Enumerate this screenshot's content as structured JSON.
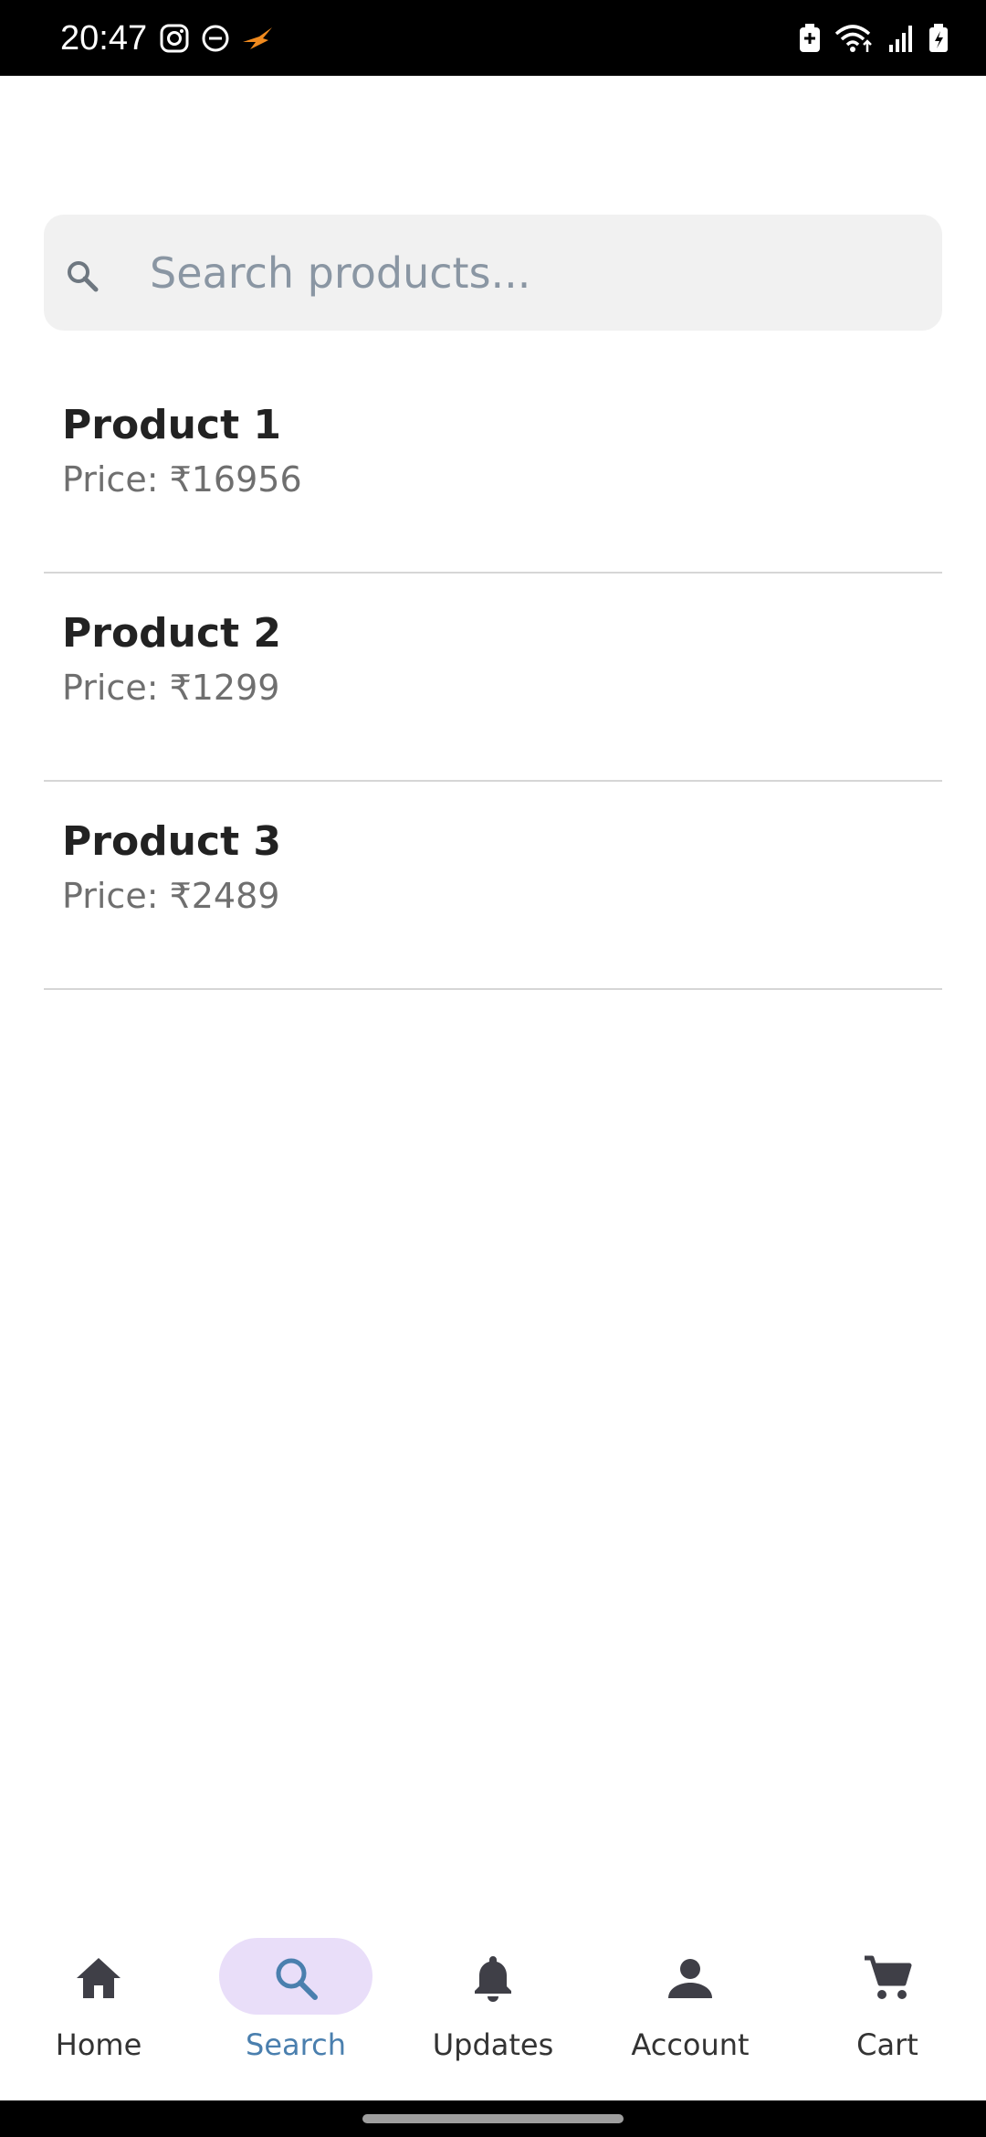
{
  "status_bar": {
    "time": "20:47",
    "left_icons": [
      "instagram-icon",
      "do-not-disturb-icon",
      "app-notification-icon"
    ],
    "right_icons": [
      "battery-saver-icon",
      "wifi-icon",
      "signal-icon",
      "battery-charging-icon"
    ]
  },
  "search": {
    "placeholder": "Search products...",
    "value": ""
  },
  "products": [
    {
      "name": "Product 1",
      "price": "Price: ₹16956"
    },
    {
      "name": "Product 2",
      "price": "Price: ₹1299"
    },
    {
      "name": "Product 3",
      "price": "Price: ₹2489"
    }
  ],
  "bottom_nav": {
    "items": [
      {
        "label": "Home",
        "icon": "home-icon",
        "active": false
      },
      {
        "label": "Search",
        "icon": "search-icon",
        "active": true
      },
      {
        "label": "Updates",
        "icon": "bell-icon",
        "active": false
      },
      {
        "label": "Account",
        "icon": "person-icon",
        "active": false
      },
      {
        "label": "Cart",
        "icon": "cart-icon",
        "active": false
      }
    ]
  },
  "colors": {
    "active_pill": "#e9def9",
    "active_label": "#4a7fae",
    "search_bg": "#f1f1f1"
  }
}
